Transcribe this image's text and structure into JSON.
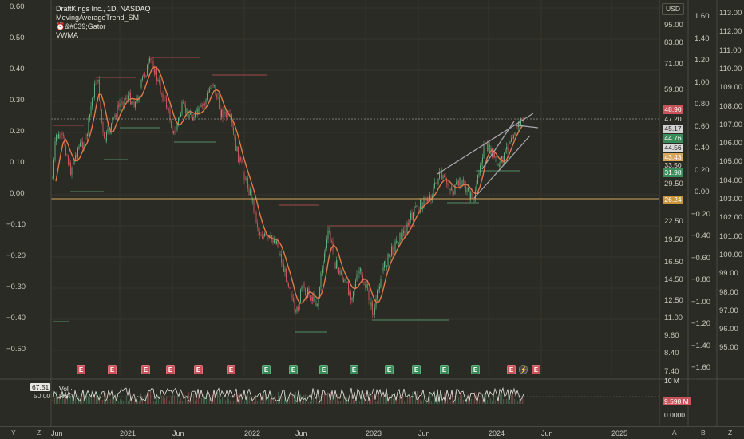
{
  "legend": {
    "title": "DraftKings Inc., 1D, NASDAQ",
    "lines": [
      "MovingAverageTrend_SM",
      "⏰&#039;Gator",
      "VWMA"
    ]
  },
  "currency_button": "USD",
  "left_axis": [
    "0.60",
    "0.50",
    "0.40",
    "0.30",
    "0.20",
    "0.10",
    "0.00",
    "−0.10",
    "−0.20",
    "−0.30",
    "−0.40",
    "−0.50"
  ],
  "price_axis": [
    "95.00",
    "83.00",
    "71.00",
    "59.00",
    "29.50",
    "22.50",
    "19.50",
    "16.50",
    "14.50",
    "12.50",
    "11.00",
    "9.60",
    "8.40",
    "7.40"
  ],
  "price_badges": [
    {
      "label": "48.90",
      "color": "#c9535a"
    },
    {
      "label": "47.20",
      "color": "#2b2b25"
    },
    {
      "label": "45.17",
      "color": "#d0d0d0"
    },
    {
      "label": "44.76",
      "color": "#3c8b5a"
    },
    {
      "label": "44.56",
      "color": "#d8d8d8"
    },
    {
      "label": "43.43",
      "color": "#d6a55a"
    },
    {
      "label": "33.50",
      "color": "#2b2b25"
    },
    {
      "label": "31.98",
      "color": "#3c8b5a"
    },
    {
      "label": "26.24",
      "color": "#c9953a"
    }
  ],
  "right_axis_1": [
    "1.60",
    "1.40",
    "1.20",
    "1.00",
    "0.80",
    "0.60",
    "0.40",
    "0.20",
    "0.00",
    "−0.20",
    "−0.40",
    "−0.60",
    "−0.80",
    "−1.00",
    "−1.20",
    "−1.40",
    "−1.60"
  ],
  "right_axis_2": [
    "113.00",
    "112.00",
    "111.00",
    "110.00",
    "109.00",
    "108.00",
    "107.00",
    "106.00",
    "105.00",
    "104.00",
    "103.00",
    "102.00",
    "101.00",
    "100.00",
    "99.00",
    "98.00",
    "97.00",
    "96.00",
    "95.00"
  ],
  "time_axis": [
    "Jun",
    "2021",
    "Jun",
    "2022",
    "Jun",
    "2023",
    "Jun",
    "2024",
    "Jun",
    "2025"
  ],
  "earnings": [
    "E",
    "E",
    "E",
    "E",
    "E",
    "E",
    "E",
    "E",
    "E",
    "E",
    "E",
    "E",
    "E",
    "E",
    "E",
    "⚡",
    "E"
  ],
  "sub_pane": {
    "value_badge": "67.51",
    "label_vol": "Vol ·",
    "label_rsi": "RSI",
    "label_50": "50.00",
    "axis_top": "10 M",
    "volume_badge": "9.598 M",
    "axis_bottom": "0.0000"
  },
  "bottom_buttons": {
    "left_y": "Y",
    "left_z": "Z",
    "right_a": "A",
    "right_b": "B",
    "right_z": "Z"
  },
  "colors": {
    "up": "#5fb07c",
    "down": "#c9535a",
    "ma": "#e07a4a",
    "zero_line": "#d6a55a",
    "channel": "#a8a8b0"
  }
}
